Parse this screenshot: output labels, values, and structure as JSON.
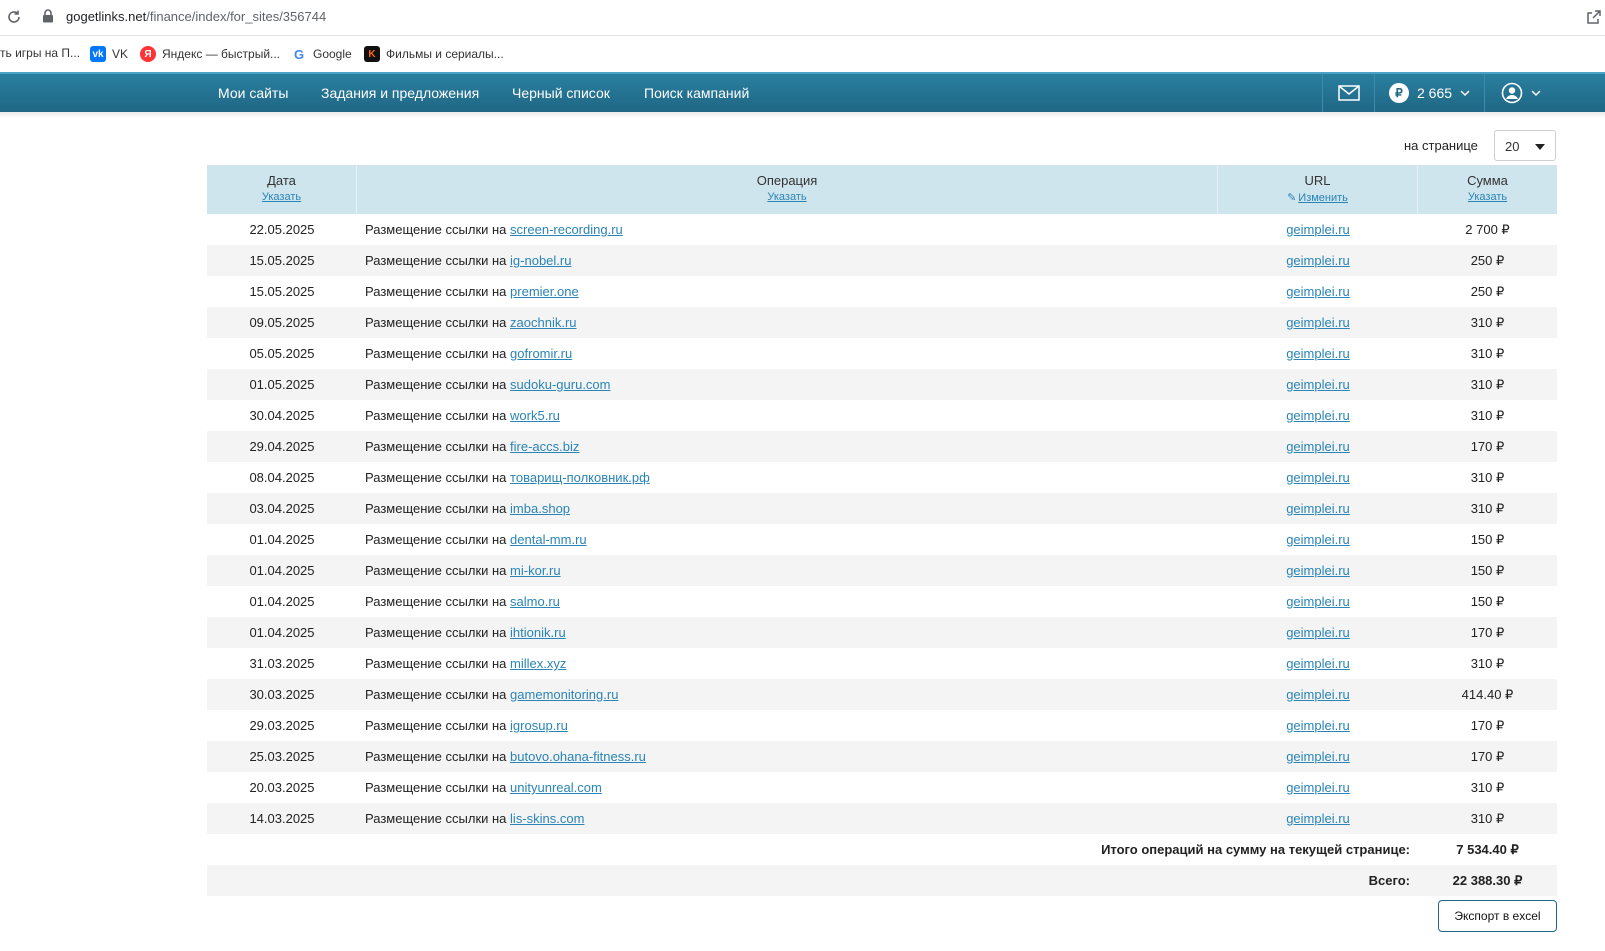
{
  "browser": {
    "url_host": "gogetlinks.net",
    "url_path": "/finance/index/for_sites/356744",
    "bookmarks": [
      {
        "label": "ть игры на П...",
        "icon": "game-bookmark-icon"
      },
      {
        "label": "VK",
        "icon": "vk-icon"
      },
      {
        "label": "Яндекс — быстрый...",
        "icon": "yandex-icon"
      },
      {
        "label": "Google",
        "icon": "google-icon"
      },
      {
        "label": "Фильмы и сериалы...",
        "icon": "kinopoisk-icon"
      }
    ]
  },
  "nav": {
    "items": [
      "Мои сайты",
      "Задания и предложения",
      "Черный список",
      "Поиск кампаний"
    ],
    "balance": "2 665",
    "balance_currency": "₽"
  },
  "pager": {
    "per_page_label": "на странице",
    "per_page_value": "20"
  },
  "table": {
    "headers": {
      "date": "Дата",
      "date_action": "Указать",
      "operation": "Операция",
      "operation_action": "Указать",
      "url": "URL",
      "url_action": "Изменить",
      "sum": "Сумма",
      "sum_action": "Указать"
    },
    "rows": [
      {
        "date": "22.05.2025",
        "op": "Размещение ссылки на",
        "site": "screen-recording.ru",
        "url": "geimplei.ru",
        "sum": "2 700 ₽"
      },
      {
        "date": "15.05.2025",
        "op": "Размещение ссылки на",
        "site": "ig-nobel.ru",
        "url": "geimplei.ru",
        "sum": "250 ₽"
      },
      {
        "date": "15.05.2025",
        "op": "Размещение ссылки на",
        "site": "premier.one",
        "url": "geimplei.ru",
        "sum": "250 ₽"
      },
      {
        "date": "09.05.2025",
        "op": "Размещение ссылки на",
        "site": "zaochnik.ru",
        "url": "geimplei.ru",
        "sum": "310 ₽"
      },
      {
        "date": "05.05.2025",
        "op": "Размещение ссылки на",
        "site": "gofromir.ru",
        "url": "geimplei.ru",
        "sum": "310 ₽"
      },
      {
        "date": "01.05.2025",
        "op": "Размещение ссылки на",
        "site": "sudoku-guru.com",
        "url": "geimplei.ru",
        "sum": "310 ₽"
      },
      {
        "date": "30.04.2025",
        "op": "Размещение ссылки на",
        "site": "work5.ru",
        "url": "geimplei.ru",
        "sum": "310 ₽"
      },
      {
        "date": "29.04.2025",
        "op": "Размещение ссылки на",
        "site": "fire-accs.biz",
        "url": "geimplei.ru",
        "sum": "170 ₽"
      },
      {
        "date": "08.04.2025",
        "op": "Размещение ссылки на",
        "site": "товарищ-полковник.рф",
        "url": "geimplei.ru",
        "sum": "310 ₽"
      },
      {
        "date": "03.04.2025",
        "op": "Размещение ссылки на",
        "site": "imba.shop",
        "url": "geimplei.ru",
        "sum": "310 ₽"
      },
      {
        "date": "01.04.2025",
        "op": "Размещение ссылки на",
        "site": "dental-mm.ru",
        "url": "geimplei.ru",
        "sum": "150 ₽"
      },
      {
        "date": "01.04.2025",
        "op": "Размещение ссылки на",
        "site": "mi-kor.ru",
        "url": "geimplei.ru",
        "sum": "150 ₽"
      },
      {
        "date": "01.04.2025",
        "op": "Размещение ссылки на",
        "site": "salmo.ru",
        "url": "geimplei.ru",
        "sum": "150 ₽"
      },
      {
        "date": "01.04.2025",
        "op": "Размещение ссылки на",
        "site": "ihtionik.ru",
        "url": "geimplei.ru",
        "sum": "170 ₽"
      },
      {
        "date": "31.03.2025",
        "op": "Размещение ссылки на",
        "site": "millex.xyz",
        "url": "geimplei.ru",
        "sum": "310 ₽"
      },
      {
        "date": "30.03.2025",
        "op": "Размещение ссылки на",
        "site": "gamemonitoring.ru",
        "url": "geimplei.ru",
        "sum": "414.40 ₽"
      },
      {
        "date": "29.03.2025",
        "op": "Размещение ссылки на",
        "site": "igrosup.ru",
        "url": "geimplei.ru",
        "sum": "170 ₽"
      },
      {
        "date": "25.03.2025",
        "op": "Размещение ссылки на",
        "site": "butovo.ohana-fitness.ru",
        "url": "geimplei.ru",
        "sum": "170 ₽"
      },
      {
        "date": "20.03.2025",
        "op": "Размещение ссылки на",
        "site": "unityunreal.com",
        "url": "geimplei.ru",
        "sum": "310 ₽"
      },
      {
        "date": "14.03.2025",
        "op": "Размещение ссылки на",
        "site": "lis-skins.com",
        "url": "geimplei.ru",
        "sum": "310 ₽"
      }
    ],
    "page_total_label": "Итого операций на сумму на текущей странице:",
    "page_total_value": "7 534.40 ₽",
    "grand_total_label": "Всего:",
    "grand_total_value": "22 388.30 ₽"
  },
  "export_label": "Экспорт в excel",
  "colors": {
    "nav_bg": "#1f6784",
    "header_bg": "#cfe5ed",
    "link": "#2a84b6",
    "row_alt": "#f4f4f4"
  }
}
